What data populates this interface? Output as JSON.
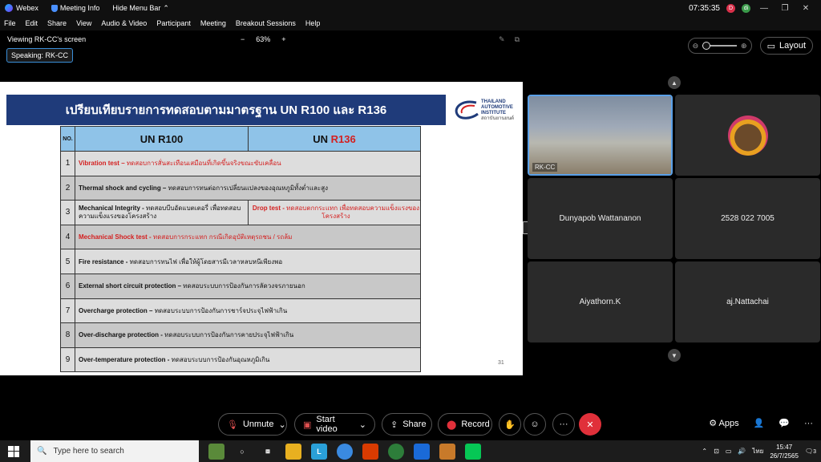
{
  "titlebar": {
    "app": "Webex",
    "meeting_info": "Meeting Info",
    "hide_menu": "Hide Menu Bar",
    "time": "07:35:35",
    "badge1": "D",
    "badge2": "di"
  },
  "menu": [
    "File",
    "Edit",
    "Share",
    "View",
    "Audio & Video",
    "Participant",
    "Meeting",
    "Breakout Sessions",
    "Help"
  ],
  "viewbar": {
    "viewing": "Viewing RK-CC's screen",
    "zoom_out": "−",
    "zoom": "63%",
    "zoom_in": "+",
    "speaking": "Speaking: RK-CC"
  },
  "slide": {
    "title": "เปรียบเทียบรายการทดสอบตามมาตรฐาน UN R100 และ R136",
    "logo_lines": [
      "THAILAND",
      "AUTOMOTIVE",
      "INSTITUTE",
      "สถาบันยานยนต์"
    ],
    "col_no": "NO.",
    "col_r100": "UN R100",
    "col_r136_prefix": "UN ",
    "col_r136_red": "R136",
    "rows": [
      {
        "no": "1",
        "head": "Vibration test –",
        "desc": " ทดสอบการสั่นสะเทือนเสมือนที่เกิดขึ้นจริงขณะขับเคลื่อน",
        "red": true
      },
      {
        "no": "2",
        "head": "Thermal shock and cycling –",
        "desc": " ทดสอบการทนต่อการเปลี่ยนแปลงของอุณหภูมิทั้งต่ำและสูง",
        "red": false
      },
      {
        "no": "3",
        "head": "Mechanical Integrity -",
        "desc": " ทดสอบบีบอัดแบตเตอรี่ เพื่อทดสอบความแข็งแรงของโครงสร้าง",
        "red": false,
        "split_head": "Drop test -",
        "split_desc": " ทดสอบตกกระแทก เพื่อทดสอบความแข็งแรงของโครงสร้าง"
      },
      {
        "no": "4",
        "head": "Mechanical Shock test -",
        "desc": " ทดสอบการกระแทก กรณีเกิดอุบัติเหตุรถชน / รถล้ม",
        "red": true
      },
      {
        "no": "5",
        "head": "Fire resistance -",
        "desc": " ทดสอบการทนไฟ เพื่อให้ผู้โดยสารมีเวลาหลบหนีเพียงพอ",
        "red": false
      },
      {
        "no": "6",
        "head": "External short circuit protection –",
        "desc": " ทดสอบระบบการป้องกันการลัดวงจรภายนอก",
        "red": false
      },
      {
        "no": "7",
        "head": "Overcharge protection –",
        "desc": " ทดสอบระบบการป้องกันการชาร์จประจุไฟฟ้าเกิน",
        "red": false
      },
      {
        "no": "8",
        "head": "Over-discharge protection -",
        "desc": " ทดสอบระบบการป้องกันการคายประจุไฟฟ้าเกิน",
        "red": false
      },
      {
        "no": "9",
        "head": "Over-temperature protection -",
        "desc": " ทดสอบระบบการป้องกันอุณหภูมิเกิน",
        "red": false
      }
    ],
    "page_number": "31"
  },
  "right_panel": {
    "layout_label": "Layout",
    "tiles": [
      {
        "name": "RK-CC"
      },
      {
        "name": ""
      },
      {
        "name": "Dunyapob Wattananon"
      },
      {
        "name": "2528 022 7005"
      },
      {
        "name": "Aiyathorn.K"
      },
      {
        "name": "aj.Nattachai"
      }
    ]
  },
  "controls": {
    "mute": "Unmute",
    "video": "Start video",
    "share": "Share",
    "record": "Record",
    "more": "···",
    "apps": "Apps",
    "end_icon": "✕"
  },
  "taskbar": {
    "search_placeholder": "Type here to search",
    "lang": "ไทย",
    "time": "15:47",
    "date": "26/7/2565",
    "notif": "3"
  },
  "colors": {
    "accent": "#3b8fd9",
    "end": "#e0303a",
    "slide_title_bg": "#1f3b7a",
    "header_bg": "#8fc3e8",
    "red": "#d42020"
  }
}
